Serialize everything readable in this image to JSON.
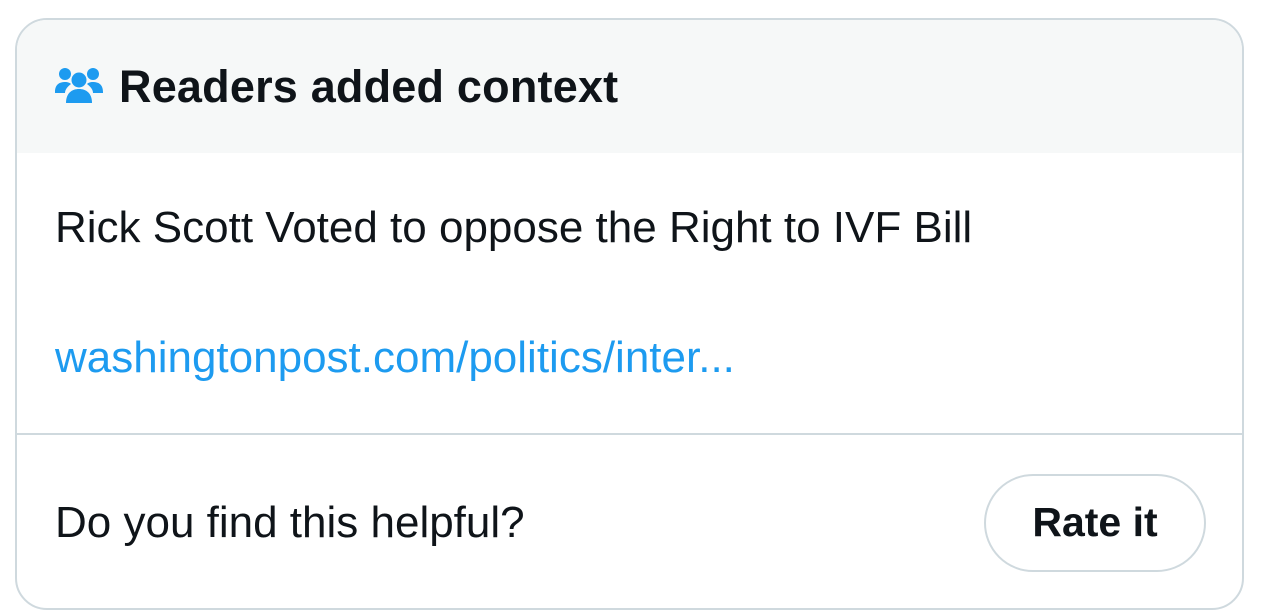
{
  "header": {
    "icon": "people-group-icon",
    "title": "Readers added context"
  },
  "note": {
    "text": "Rick Scott Voted to oppose the Right to IVF Bill",
    "link": "washingtonpost.com/politics/inter..."
  },
  "footer": {
    "question": "Do you find this helpful?",
    "rate_label": "Rate it"
  },
  "colors": {
    "accent": "#1d9bf0",
    "text": "#0f1419",
    "border": "#cfd9de",
    "header_bg": "#f6f8f8"
  }
}
